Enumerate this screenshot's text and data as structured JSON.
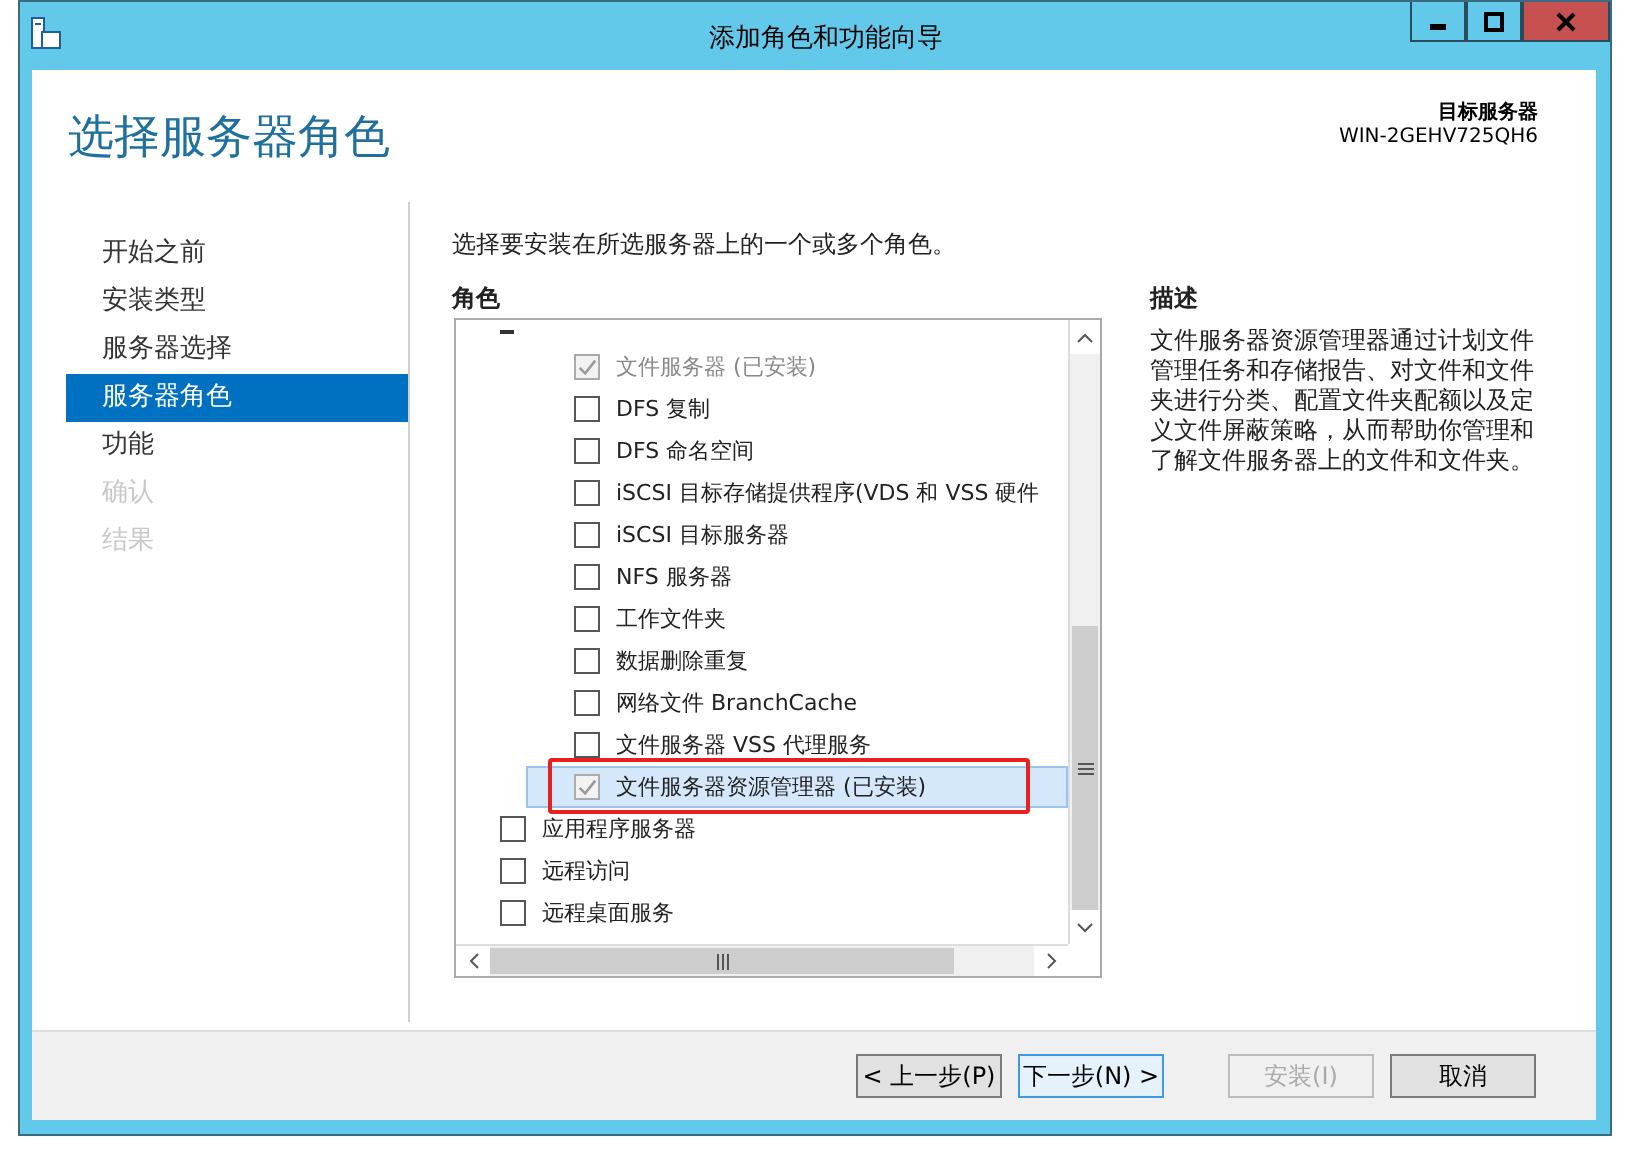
{
  "window": {
    "title": "添加角色和功能向导"
  },
  "header": {
    "title": "选择服务器角色",
    "target_label": "目标服务器",
    "target_server": "WIN-2GEHV725QH6"
  },
  "nav": [
    {
      "label": "开始之前",
      "selected": false,
      "disabled": false
    },
    {
      "label": "安装类型",
      "selected": false,
      "disabled": false
    },
    {
      "label": "服务器选择",
      "selected": false,
      "disabled": false
    },
    {
      "label": "服务器角色",
      "selected": true,
      "disabled": false
    },
    {
      "label": "功能",
      "selected": false,
      "disabled": false
    },
    {
      "label": "确认",
      "selected": false,
      "disabled": true
    },
    {
      "label": "结果",
      "selected": false,
      "disabled": true
    }
  ],
  "instruction": "选择要安装在所选服务器上的一个或多个角色。",
  "roles_heading": "角色",
  "roles": [
    {
      "expanded": true,
      "children": [
        {
          "label": "文件服务器 (已安装)",
          "checked": true,
          "disabled": true,
          "selected": false,
          "highlighted": false
        },
        {
          "label": "DFS 复制",
          "checked": false,
          "disabled": false,
          "selected": false,
          "highlighted": false
        },
        {
          "label": "DFS 命名空间",
          "checked": false,
          "disabled": false,
          "selected": false,
          "highlighted": false
        },
        {
          "label": "iSCSI 目标存储提供程序(VDS 和 VSS 硬件",
          "checked": false,
          "disabled": false,
          "selected": false,
          "highlighted": false
        },
        {
          "label": "iSCSI 目标服务器",
          "checked": false,
          "disabled": false,
          "selected": false,
          "highlighted": false
        },
        {
          "label": "NFS 服务器",
          "checked": false,
          "disabled": false,
          "selected": false,
          "highlighted": false
        },
        {
          "label": "工作文件夹",
          "checked": false,
          "disabled": false,
          "selected": false,
          "highlighted": false
        },
        {
          "label": "数据删除重复",
          "checked": false,
          "disabled": false,
          "selected": false,
          "highlighted": false
        },
        {
          "label": "网络文件 BranchCache",
          "checked": false,
          "disabled": false,
          "selected": false,
          "highlighted": false
        },
        {
          "label": "文件服务器 VSS 代理服务",
          "checked": false,
          "disabled": false,
          "selected": false,
          "highlighted": false
        },
        {
          "label": "文件服务器资源管理器 (已安装)",
          "checked": true,
          "disabled": true,
          "selected": true,
          "highlighted": true
        }
      ]
    },
    {
      "label": "应用程序服务器",
      "checked": false,
      "disabled": false,
      "selected": false,
      "highlighted": false
    },
    {
      "label": "远程访问",
      "checked": false,
      "disabled": false,
      "selected": false,
      "highlighted": false
    },
    {
      "label": "远程桌面服务",
      "checked": false,
      "disabled": false,
      "selected": false,
      "highlighted": false
    }
  ],
  "description_heading": "描述",
  "description": "文件服务器资源管理器通过计划文件管理任务和存储报告、对文件和文件夹进行分类、配置文件夹配额以及定义文件屏蔽策略，从而帮助你管理和了解文件服务器上的文件和文件夹。",
  "buttons": [
    {
      "label": "< 上一步(P)",
      "disabled": false,
      "focused": false
    },
    {
      "label": "下一步(N) >",
      "disabled": false,
      "focused": true
    },
    {
      "label": "安装(I)",
      "disabled": true,
      "focused": false
    },
    {
      "label": "取消",
      "disabled": false,
      "focused": false
    }
  ]
}
